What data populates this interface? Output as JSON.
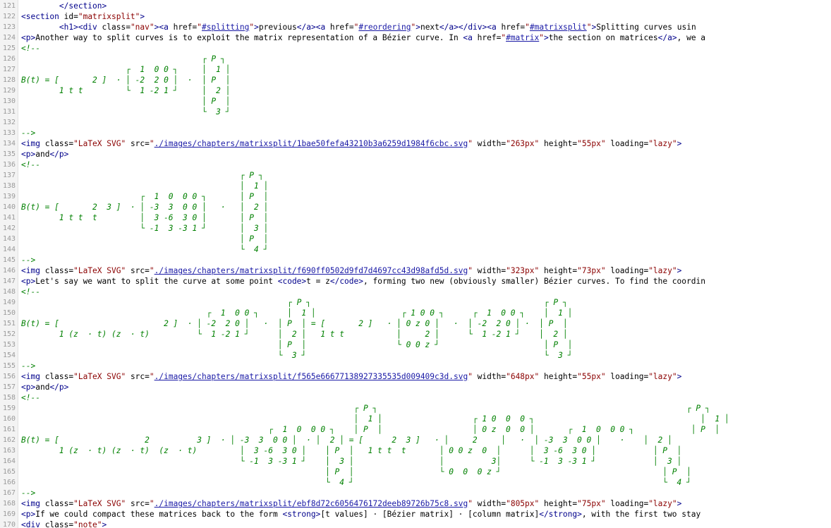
{
  "lines": [
    {
      "n": "121",
      "parts": [
        [
          "txt",
          "        "
        ],
        [
          "tag",
          "</section>"
        ]
      ]
    },
    {
      "n": "122",
      "parts": [
        [
          "tag",
          "<section "
        ],
        [
          "an",
          "id="
        ],
        [
          "av",
          "\"matrixsplit\""
        ],
        [
          "tag",
          ">"
        ]
      ]
    },
    {
      "n": "123",
      "parts": [
        [
          "txt",
          "        "
        ],
        [
          "tag",
          "<h1><div "
        ],
        [
          "an",
          "class="
        ],
        [
          "av",
          "\"nav\""
        ],
        [
          "tag",
          "><a "
        ],
        [
          "an",
          "href="
        ],
        [
          "av",
          "\""
        ],
        [
          "lnk",
          "#splitting"
        ],
        [
          "av",
          "\""
        ],
        [
          "tag",
          ">"
        ],
        [
          "txt",
          "previous"
        ],
        [
          "tag",
          "</a><a "
        ],
        [
          "an",
          "href="
        ],
        [
          "av",
          "\""
        ],
        [
          "lnk",
          "#reordering"
        ],
        [
          "av",
          "\""
        ],
        [
          "tag",
          ">"
        ],
        [
          "txt",
          "next"
        ],
        [
          "tag",
          "</a></div><a "
        ],
        [
          "an",
          "href="
        ],
        [
          "av",
          "\""
        ],
        [
          "lnk",
          "#matrixsplit"
        ],
        [
          "av",
          "\""
        ],
        [
          "tag",
          ">"
        ],
        [
          "txt",
          "Splitting curves usin"
        ]
      ]
    },
    {
      "n": "124",
      "parts": [
        [
          "tag",
          "<p>"
        ],
        [
          "txt",
          "Another way to split curves is to exploit the matrix representation of a Bézier curve. In "
        ],
        [
          "tag",
          "<a "
        ],
        [
          "an",
          "href="
        ],
        [
          "av",
          "\""
        ],
        [
          "lnk",
          "#matrix"
        ],
        [
          "av",
          "\""
        ],
        [
          "tag",
          ">"
        ],
        [
          "txt",
          "the section on matrices"
        ],
        [
          "tag",
          "</a>"
        ],
        [
          "txt",
          ", we a"
        ]
      ]
    },
    {
      "n": "125",
      "parts": [
        [
          "cm",
          "<!--"
        ]
      ]
    },
    {
      "n": "126",
      "parts": [
        [
          "cm",
          "                                      ┌ P ┐"
        ]
      ]
    },
    {
      "n": "127",
      "parts": [
        [
          "cm",
          "                      ┌  1  0 0 ┐     │  1 │"
        ]
      ]
    },
    {
      "n": "128",
      "parts": [
        [
          "cm",
          "B(t) = [       2 ]  · │ -2  2 0 │  ·  │ P  │"
        ]
      ]
    },
    {
      "n": "129",
      "parts": [
        [
          "cm",
          "        1 t t         └  1 -2 1 ┘     │  2 │"
        ]
      ]
    },
    {
      "n": "130",
      "parts": [
        [
          "cm",
          "                                      │ P  │"
        ]
      ]
    },
    {
      "n": "131",
      "parts": [
        [
          "cm",
          "                                      └  3 ┘"
        ]
      ]
    },
    {
      "n": "132",
      "parts": [
        [
          "cm",
          ""
        ]
      ]
    },
    {
      "n": "133",
      "parts": [
        [
          "cm",
          "-->"
        ]
      ]
    },
    {
      "n": "134",
      "parts": [
        [
          "tag",
          "<img "
        ],
        [
          "an",
          "class="
        ],
        [
          "av",
          "\"LaTeX SVG\" "
        ],
        [
          "an",
          "src="
        ],
        [
          "av",
          "\""
        ],
        [
          "lnk",
          "./images/chapters/matrixsplit/1bae50fefa43210b3a6259d1984f6cbc.svg"
        ],
        [
          "av",
          "\" "
        ],
        [
          "an",
          "width="
        ],
        [
          "av",
          "\"263px\" "
        ],
        [
          "an",
          "height="
        ],
        [
          "av",
          "\"55px\" "
        ],
        [
          "an",
          "loading="
        ],
        [
          "av",
          "\"lazy\""
        ],
        [
          "tag",
          ">"
        ]
      ]
    },
    {
      "n": "135",
      "parts": [
        [
          "tag",
          "<p>"
        ],
        [
          "txt",
          "and"
        ],
        [
          "tag",
          "</p>"
        ]
      ]
    },
    {
      "n": "136",
      "parts": [
        [
          "cm",
          "<!--"
        ]
      ]
    },
    {
      "n": "137",
      "parts": [
        [
          "cm",
          "                                              ┌ P ┐"
        ]
      ]
    },
    {
      "n": "138",
      "parts": [
        [
          "cm",
          "                                              │  1 │"
        ]
      ]
    },
    {
      "n": "139",
      "parts": [
        [
          "cm",
          "                         ┌  1  0  0 0 ┐       │ P  │"
        ]
      ]
    },
    {
      "n": "140",
      "parts": [
        [
          "cm",
          "B(t) = [       2  3 ]  · │ -3  3  0 0 │   ·   │  2 │"
        ]
      ]
    },
    {
      "n": "141",
      "parts": [
        [
          "cm",
          "        1 t t  t         │  3 -6  3 0 │       │ P  │"
        ]
      ]
    },
    {
      "n": "142",
      "parts": [
        [
          "cm",
          "                         └ -1  3 -3 1 ┘       │  3 │"
        ]
      ]
    },
    {
      "n": "143",
      "parts": [
        [
          "cm",
          "                                              │ P  │"
        ]
      ]
    },
    {
      "n": "144",
      "parts": [
        [
          "cm",
          "                                              └  4 ┘"
        ]
      ]
    },
    {
      "n": "145",
      "parts": [
        [
          "cm",
          "-->"
        ]
      ]
    },
    {
      "n": "146",
      "parts": [
        [
          "tag",
          "<img "
        ],
        [
          "an",
          "class="
        ],
        [
          "av",
          "\"LaTeX SVG\" "
        ],
        [
          "an",
          "src="
        ],
        [
          "av",
          "\""
        ],
        [
          "lnk",
          "./images/chapters/matrixsplit/f690ff0502d9fd7d4697cc43d98afd5d.svg"
        ],
        [
          "av",
          "\" "
        ],
        [
          "an",
          "width="
        ],
        [
          "av",
          "\"323px\" "
        ],
        [
          "an",
          "height="
        ],
        [
          "av",
          "\"73px\" "
        ],
        [
          "an",
          "loading="
        ],
        [
          "av",
          "\"lazy\""
        ],
        [
          "tag",
          ">"
        ]
      ]
    },
    {
      "n": "147",
      "parts": [
        [
          "tag",
          "<p>"
        ],
        [
          "txt",
          "Let's say we want to split the curve at some point "
        ],
        [
          "tag",
          "<code>"
        ],
        [
          "txt",
          "t = z"
        ],
        [
          "tag",
          "</code>"
        ],
        [
          "txt",
          ", forming two new (obviously smaller) Bézier curves. To find the coordin"
        ]
      ]
    },
    {
      "n": "148",
      "parts": [
        [
          "cm",
          "<!--"
        ]
      ]
    },
    {
      "n": "149",
      "parts": [
        [
          "cm",
          "                                                        ┌ P ┐                                                 ┌ P ┐"
        ]
      ]
    },
    {
      "n": "150",
      "parts": [
        [
          "cm",
          "                                       ┌  1  0 0 ┐      │  1 │                  ┌ 1 0 0 ┐      ┌  1  0 0 ┐    │  1 │"
        ]
      ]
    },
    {
      "n": "151",
      "parts": [
        [
          "cm",
          "B(t) = [                      2 ]  · │ -2  2 0 │   ·  │ P  │ = [       2 ]   · │ 0 z 0 │   ·  │ -2  2 0 │ ·  │ P  │"
        ]
      ]
    },
    {
      "n": "152",
      "parts": [
        [
          "cm",
          "        1 (z  · t) (z  · t)          └  1 -2 1 ┘      │  2 │   1 t t           │     2 │      └  1 -2 1 ┘    │  2 │"
        ]
      ]
    },
    {
      "n": "153",
      "parts": [
        [
          "cm",
          "                                                      │ P  │                   └ 0 0 z ┘                      │ P  │"
        ]
      ]
    },
    {
      "n": "154",
      "parts": [
        [
          "cm",
          "                                                      └  3 ┘                                                  └  3 ┘"
        ]
      ]
    },
    {
      "n": "155",
      "parts": [
        [
          "cm",
          "-->"
        ]
      ]
    },
    {
      "n": "156",
      "parts": [
        [
          "tag",
          "<img "
        ],
        [
          "an",
          "class="
        ],
        [
          "av",
          "\"LaTeX SVG\" "
        ],
        [
          "an",
          "src="
        ],
        [
          "av",
          "\""
        ],
        [
          "lnk",
          "./images/chapters/matrixsplit/f565e66677138927335535d009409c3d.svg"
        ],
        [
          "av",
          "\" "
        ],
        [
          "an",
          "width="
        ],
        [
          "av",
          "\"648px\" "
        ],
        [
          "an",
          "height="
        ],
        [
          "av",
          "\"55px\" "
        ],
        [
          "an",
          "loading="
        ],
        [
          "av",
          "\"lazy\""
        ],
        [
          "tag",
          ">"
        ]
      ]
    },
    {
      "n": "157",
      "parts": [
        [
          "tag",
          "<p>"
        ],
        [
          "txt",
          "and"
        ],
        [
          "tag",
          "</p>"
        ]
      ]
    },
    {
      "n": "158",
      "parts": [
        [
          "cm",
          "<!--"
        ]
      ]
    },
    {
      "n": "159",
      "parts": [
        [
          "cm",
          "                                                                      ┌ P ┐                                                                 ┌ P ┐"
        ]
      ]
    },
    {
      "n": "160",
      "parts": [
        [
          "cm",
          "                                                                      │  1 │                   ┌ 1 0  0  0 ┐                                   │  1 │"
        ]
      ]
    },
    {
      "n": "161",
      "parts": [
        [
          "cm",
          "                                                    ┌  1  0  0 0 ┐    │ P  │                   │ 0 z  0  0 │       ┌  1  0  0 0 ┐            │ P  │"
        ]
      ]
    },
    {
      "n": "162",
      "parts": [
        [
          "cm",
          "B(t) = [                  2          3 ]  · │ -3  3  0 0 │  · │  2 │ = [      2  3 ]   · │     2     │   ·  │ -3  3  0 0 │    ·    │  2 │"
        ]
      ]
    },
    {
      "n": "163",
      "parts": [
        [
          "cm",
          "        1 (z  · t) (z  · t)  (z  · t)         │  3 -6  3 0 │    │ P  │   1 t t  t       │ 0 0 z  0  │      │  3 -6  3 0 │            │ P  │"
        ]
      ]
    },
    {
      "n": "164",
      "parts": [
        [
          "cm",
          "                                              └ -1  3 -3 1 ┘    │  3 │                  │          3│      └ -1  3 -3 1 ┘            │  3 │"
        ]
      ]
    },
    {
      "n": "165",
      "parts": [
        [
          "cm",
          "                                                                │ P  │                  └ 0  0  0 z ┘                                  │ P  │"
        ]
      ]
    },
    {
      "n": "166",
      "parts": [
        [
          "cm",
          "                                                                └  4 ┘                                                                 └  4 ┘"
        ]
      ]
    },
    {
      "n": "167",
      "parts": [
        [
          "cm",
          "-->"
        ]
      ]
    },
    {
      "n": "168",
      "parts": [
        [
          "tag",
          "<img "
        ],
        [
          "an",
          "class="
        ],
        [
          "av",
          "\"LaTeX SVG\" "
        ],
        [
          "an",
          "src="
        ],
        [
          "av",
          "\""
        ],
        [
          "lnk",
          "./images/chapters/matrixsplit/ebf8d72c6056476172deeb89726b75c8.svg"
        ],
        [
          "av",
          "\" "
        ],
        [
          "an",
          "width="
        ],
        [
          "av",
          "\"805px\" "
        ],
        [
          "an",
          "height="
        ],
        [
          "av",
          "\"75px\" "
        ],
        [
          "an",
          "loading="
        ],
        [
          "av",
          "\"lazy\""
        ],
        [
          "tag",
          ">"
        ]
      ]
    },
    {
      "n": "169",
      "parts": [
        [
          "tag",
          "<p>"
        ],
        [
          "txt",
          "If we could compact these matrices back to the form "
        ],
        [
          "tag",
          "<strong>"
        ],
        [
          "txt",
          "[t values] · [Bézier matrix] · [column matrix]"
        ],
        [
          "tag",
          "</strong>"
        ],
        [
          "txt",
          ", with the first two stay"
        ]
      ]
    },
    {
      "n": "170",
      "parts": [
        [
          "tag",
          "<div "
        ],
        [
          "an",
          "class="
        ],
        [
          "av",
          "\"note\""
        ],
        [
          "tag",
          ">"
        ]
      ]
    }
  ]
}
